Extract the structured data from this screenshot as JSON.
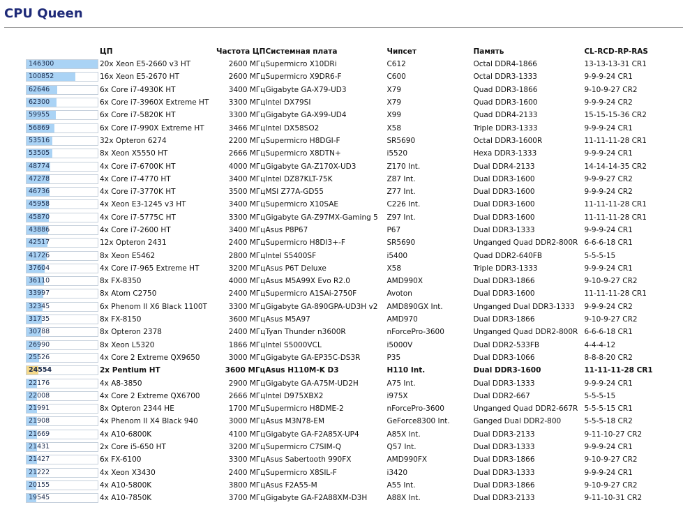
{
  "title": "CPU Queen",
  "colors": {
    "title": "#1e2a78",
    "bar": "#aad3f5",
    "bar_highlight": "#f5d98a"
  },
  "max_score": 146300,
  "headers": {
    "score": "",
    "cpu": "ЦП",
    "freq": "Частота ЦП",
    "board": "Системная плата",
    "chipset": "Чипсет",
    "memory": "Память",
    "timing": "CL-RCD-RP-RAS"
  },
  "rows": [
    {
      "score": "146300",
      "cpu": "20x Xeon E5-2660 v3 HT",
      "freq": "2600 МГц",
      "board": "Supermicro X10DRi",
      "chipset": "C612",
      "memory": "Octal DDR4-1866",
      "timing": "13-13-13-31 CR1"
    },
    {
      "score": "100852",
      "cpu": "16x Xeon E5-2670 HT",
      "freq": "2600 МГц",
      "board": "Supermicro X9DR6-F",
      "chipset": "C600",
      "memory": "Octal DDR3-1333",
      "timing": "9-9-9-24 CR1"
    },
    {
      "score": "62646",
      "cpu": "6x Core i7-4930K HT",
      "freq": "3400 МГц",
      "board": "Gigabyte GA-X79-UD3",
      "chipset": "X79",
      "memory": "Quad DDR3-1866",
      "timing": "9-10-9-27 CR2"
    },
    {
      "score": "62300",
      "cpu": "6x Core i7-3960X Extreme HT",
      "freq": "3300 МГц",
      "board": "Intel DX79SI",
      "chipset": "X79",
      "memory": "Quad DDR3-1600",
      "timing": "9-9-9-24 CR2"
    },
    {
      "score": "59955",
      "cpu": "6x Core i7-5820K HT",
      "freq": "3300 МГц",
      "board": "Gigabyte GA-X99-UD4",
      "chipset": "X99",
      "memory": "Quad DDR4-2133",
      "timing": "15-15-15-36 CR2"
    },
    {
      "score": "56869",
      "cpu": "6x Core i7-990X Extreme HT",
      "freq": "3466 МГц",
      "board": "Intel DX58SO2",
      "chipset": "X58",
      "memory": "Triple DDR3-1333",
      "timing": "9-9-9-24 CR1"
    },
    {
      "score": "53516",
      "cpu": "32x Opteron 6274",
      "freq": "2200 МГц",
      "board": "Supermicro H8DGI-F",
      "chipset": "SR5690",
      "memory": "Octal DDR3-1600R",
      "timing": "11-11-11-28 CR1"
    },
    {
      "score": "53505",
      "cpu": "8x Xeon X5550 HT",
      "freq": "2666 МГц",
      "board": "Supermicro X8DTN+",
      "chipset": "i5520",
      "memory": "Hexa DDR3-1333",
      "timing": "9-9-9-24 CR1"
    },
    {
      "score": "48774",
      "cpu": "4x Core i7-6700K HT",
      "freq": "4000 МГц",
      "board": "Gigabyte GA-Z170X-UD3",
      "chipset": "Z170 Int.",
      "memory": "Dual DDR4-2133",
      "timing": "14-14-14-35 CR2"
    },
    {
      "score": "47278",
      "cpu": "4x Core i7-4770 HT",
      "freq": "3400 МГц",
      "board": "Intel DZ87KLT-75K",
      "chipset": "Z87 Int.",
      "memory": "Dual DDR3-1600",
      "timing": "9-9-9-27 CR2"
    },
    {
      "score": "46736",
      "cpu": "4x Core i7-3770K HT",
      "freq": "3500 МГц",
      "board": "MSI Z77A-GD55",
      "chipset": "Z77 Int.",
      "memory": "Dual DDR3-1600",
      "timing": "9-9-9-24 CR2"
    },
    {
      "score": "45958",
      "cpu": "4x Xeon E3-1245 v3 HT",
      "freq": "3400 МГц",
      "board": "Supermicro X10SAE",
      "chipset": "C226 Int.",
      "memory": "Dual DDR3-1600",
      "timing": "11-11-11-28 CR1"
    },
    {
      "score": "45870",
      "cpu": "4x Core i7-5775C HT",
      "freq": "3300 МГц",
      "board": "Gigabyte GA-Z97MX-Gaming 5",
      "chipset": "Z97 Int.",
      "memory": "Dual DDR3-1600",
      "timing": "11-11-11-28 CR1"
    },
    {
      "score": "43886",
      "cpu": "4x Core i7-2600 HT",
      "freq": "3400 МГц",
      "board": "Asus P8P67",
      "chipset": "P67",
      "memory": "Dual DDR3-1333",
      "timing": "9-9-9-24 CR1"
    },
    {
      "score": "42517",
      "cpu": "12x Opteron 2431",
      "freq": "2400 МГц",
      "board": "Supermicro H8DI3+-F",
      "chipset": "SR5690",
      "memory": "Unganged Quad DDR2-800R",
      "timing": "6-6-6-18 CR1"
    },
    {
      "score": "41726",
      "cpu": "8x Xeon E5462",
      "freq": "2800 МГц",
      "board": "Intel S5400SF",
      "chipset": "i5400",
      "memory": "Quad DDR2-640FB",
      "timing": "5-5-5-15"
    },
    {
      "score": "37604",
      "cpu": "4x Core i7-965 Extreme HT",
      "freq": "3200 МГц",
      "board": "Asus P6T Deluxe",
      "chipset": "X58",
      "memory": "Triple DDR3-1333",
      "timing": "9-9-9-24 CR1"
    },
    {
      "score": "36110",
      "cpu": "8x FX-8350",
      "freq": "4000 МГц",
      "board": "Asus M5A99X Evo R2.0",
      "chipset": "AMD990X",
      "memory": "Dual DDR3-1866",
      "timing": "9-10-9-27 CR2"
    },
    {
      "score": "33997",
      "cpu": "8x Atom C2750",
      "freq": "2400 МГц",
      "board": "Supermicro A1SAi-2750F",
      "chipset": "Avoton",
      "memory": "Dual DDR3-1600",
      "timing": "11-11-11-28 CR1"
    },
    {
      "score": "32345",
      "cpu": "6x Phenom II X6 Black 1100T",
      "freq": "3300 МГц",
      "board": "Gigabyte GA-890GPA-UD3H v2",
      "chipset": "AMD890GX Int.",
      "memory": "Unganged Dual DDR3-1333",
      "timing": "9-9-9-24 CR2"
    },
    {
      "score": "31735",
      "cpu": "8x FX-8150",
      "freq": "3600 МГц",
      "board": "Asus M5A97",
      "chipset": "AMD970",
      "memory": "Dual DDR3-1866",
      "timing": "9-10-9-27 CR2"
    },
    {
      "score": "30788",
      "cpu": "8x Opteron 2378",
      "freq": "2400 МГц",
      "board": "Tyan Thunder n3600R",
      "chipset": "nForcePro-3600",
      "memory": "Unganged Quad DDR2-800R",
      "timing": "6-6-6-18 CR1"
    },
    {
      "score": "26990",
      "cpu": "8x Xeon L5320",
      "freq": "1866 МГц",
      "board": "Intel S5000VCL",
      "chipset": "i5000V",
      "memory": "Dual DDR2-533FB",
      "timing": "4-4-4-12"
    },
    {
      "score": "25526",
      "cpu": "4x Core 2 Extreme QX9650",
      "freq": "3000 МГц",
      "board": "Gigabyte GA-EP35C-DS3R",
      "chipset": "P35",
      "memory": "Dual DDR3-1066",
      "timing": "8-8-8-20 CR2"
    },
    {
      "score": "24554",
      "cpu": "2x Pentium HT",
      "freq": "3600 МГц",
      "board": "Asus H110M-K D3",
      "chipset": "H110 Int.",
      "memory": "Dual DDR3-1600",
      "timing": "11-11-11-28 CR1",
      "highlight": true
    },
    {
      "score": "22176",
      "cpu": "4x A8-3850",
      "freq": "2900 МГц",
      "board": "Gigabyte GA-A75M-UD2H",
      "chipset": "A75 Int.",
      "memory": "Dual DDR3-1333",
      "timing": "9-9-9-24 CR1"
    },
    {
      "score": "22008",
      "cpu": "4x Core 2 Extreme QX6700",
      "freq": "2666 МГц",
      "board": "Intel D975XBX2",
      "chipset": "i975X",
      "memory": "Dual DDR2-667",
      "timing": "5-5-5-15"
    },
    {
      "score": "21991",
      "cpu": "8x Opteron 2344 HE",
      "freq": "1700 МГц",
      "board": "Supermicro H8DME-2",
      "chipset": "nForcePro-3600",
      "memory": "Unganged Quad DDR2-667R",
      "timing": "5-5-5-15 CR1"
    },
    {
      "score": "21908",
      "cpu": "4x Phenom II X4 Black 940",
      "freq": "3000 МГц",
      "board": "Asus M3N78-EM",
      "chipset": "GeForce8300 Int.",
      "memory": "Ganged Dual DDR2-800",
      "timing": "5-5-5-18 CR2"
    },
    {
      "score": "21669",
      "cpu": "4x A10-6800K",
      "freq": "4100 МГц",
      "board": "Gigabyte GA-F2A85X-UP4",
      "chipset": "A85X Int.",
      "memory": "Dual DDR3-2133",
      "timing": "9-11-10-27 CR2"
    },
    {
      "score": "21431",
      "cpu": "2x Core i5-650 HT",
      "freq": "3200 МГц",
      "board": "Supermicro C7SIM-Q",
      "chipset": "Q57 Int.",
      "memory": "Dual DDR3-1333",
      "timing": "9-9-9-24 CR1"
    },
    {
      "score": "21427",
      "cpu": "6x FX-6100",
      "freq": "3300 МГц",
      "board": "Asus Sabertooth 990FX",
      "chipset": "AMD990FX",
      "memory": "Dual DDR3-1866",
      "timing": "9-10-9-27 CR2"
    },
    {
      "score": "21222",
      "cpu": "4x Xeon X3430",
      "freq": "2400 МГц",
      "board": "Supermicro X8SIL-F",
      "chipset": "i3420",
      "memory": "Dual DDR3-1333",
      "timing": "9-9-9-24 CR1"
    },
    {
      "score": "20155",
      "cpu": "4x A10-5800K",
      "freq": "3800 МГц",
      "board": "Asus F2A55-M",
      "chipset": "A55 Int.",
      "memory": "Dual DDR3-1866",
      "timing": "9-10-9-27 CR2"
    },
    {
      "score": "19545",
      "cpu": "4x A10-7850K",
      "freq": "3700 МГц",
      "board": "Gigabyte GA-F2A88XM-D3H",
      "chipset": "A88X Int.",
      "memory": "Dual DDR3-2133",
      "timing": "9-11-10-31 CR2"
    }
  ]
}
